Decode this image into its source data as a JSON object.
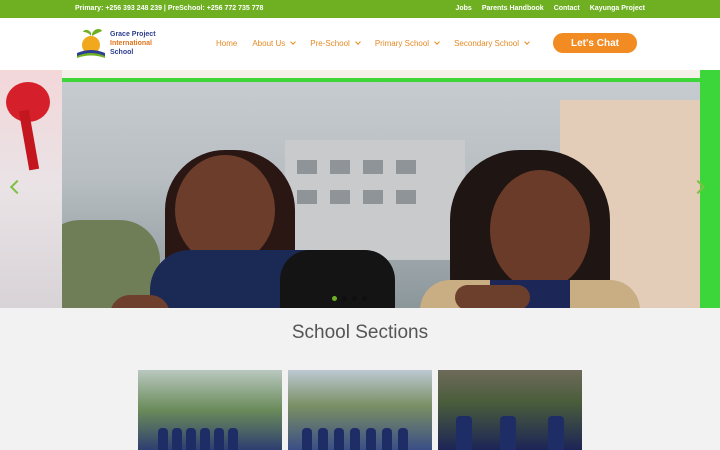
{
  "topbar": {
    "phones": "Primary: +256 393 248 239 | PreSchool: +256 772 735 778",
    "links": [
      "Jobs",
      "Parents Handbook",
      "Contact",
      "Kayunga Project"
    ]
  },
  "logo": {
    "line1": "Grace Project",
    "line2": "International",
    "line3": "School"
  },
  "nav": {
    "items": [
      {
        "label": "Home",
        "has_dropdown": false
      },
      {
        "label": "About Us",
        "has_dropdown": true
      },
      {
        "label": "Pre-School",
        "has_dropdown": true
      },
      {
        "label": "Primary School",
        "has_dropdown": true
      },
      {
        "label": "Secondary School",
        "has_dropdown": true
      }
    ],
    "cta": "Let's Chat"
  },
  "hero": {
    "slide_count": 4,
    "active_slide": 1
  },
  "sections": {
    "title": "School Sections"
  },
  "colors": {
    "topbar": "#6fb023",
    "nav_text": "#e58a25",
    "cta": "#f28b22",
    "accent_green": "#7cc142"
  }
}
